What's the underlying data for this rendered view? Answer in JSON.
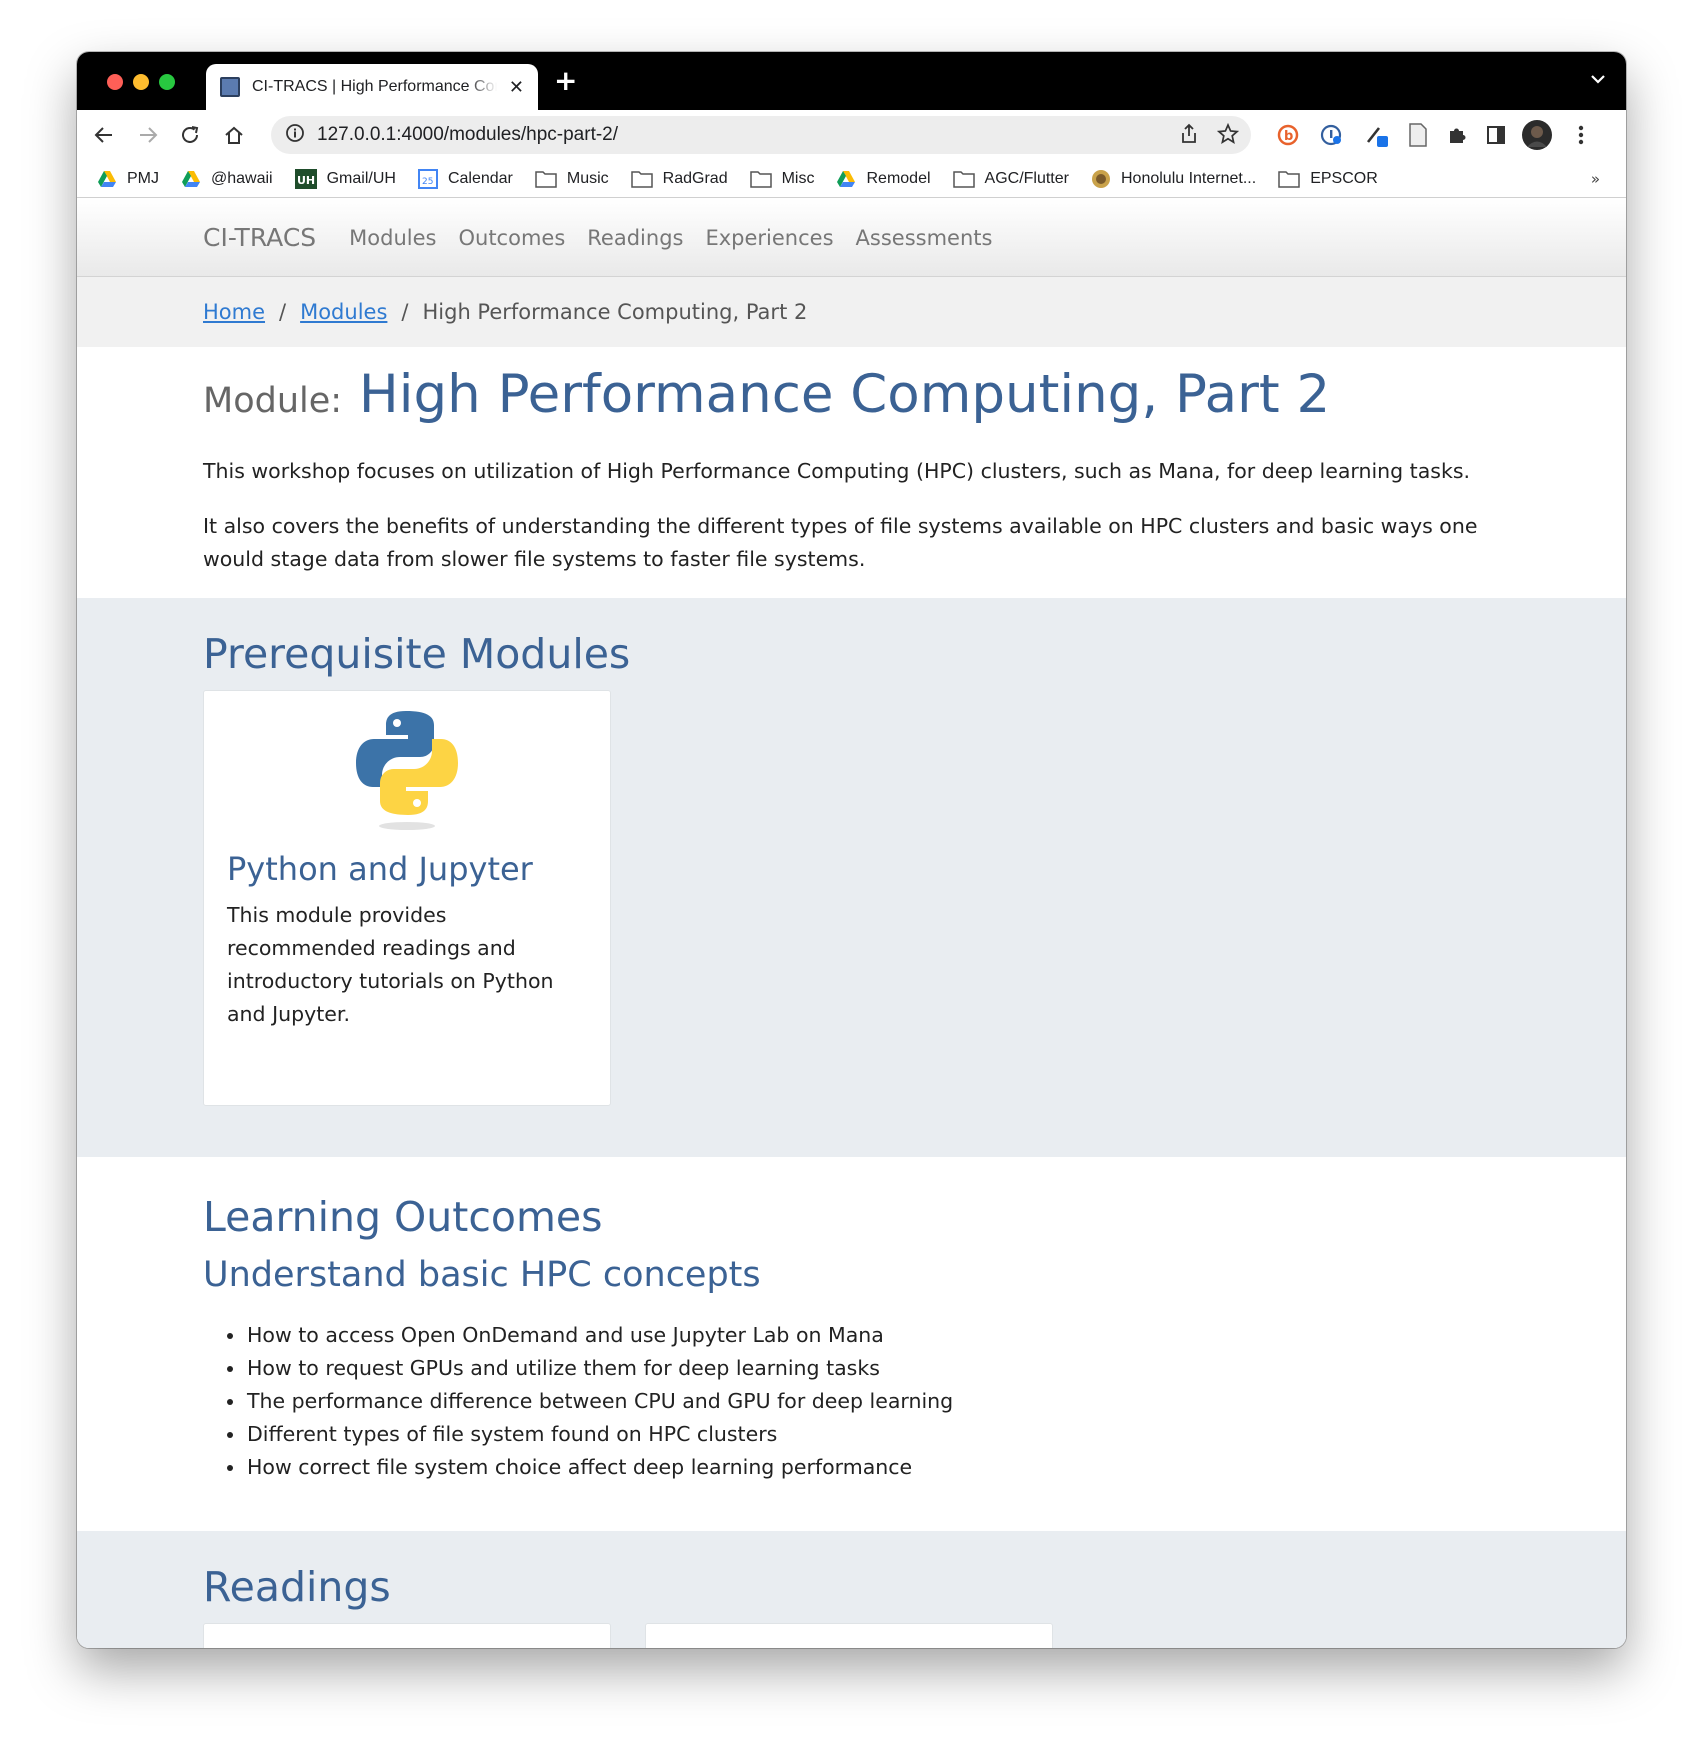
{
  "browser": {
    "tab_title": "CI-TRACS | High Performance Computing, Part 2",
    "url": "127.0.0.1:4000/modules/hpc-part-2/",
    "bookmarks": [
      "PMJ",
      "@hawaii",
      "Gmail/UH",
      "Calendar",
      "Music",
      "RadGrad",
      "Misc",
      "Remodel",
      "AGC/Flutter",
      "Honolulu Internet...",
      "EPSCOR"
    ],
    "bookmarks_more": "»",
    "close_glyph": "✕",
    "new_tab_glyph": "+"
  },
  "site": {
    "brand": "CI-TRACS",
    "nav": [
      "Modules",
      "Outcomes",
      "Readings",
      "Experiences",
      "Assessments"
    ]
  },
  "breadcrumb": {
    "home": "Home",
    "modules": "Modules",
    "separator": "/",
    "current": "High Performance Computing, Part 2"
  },
  "module": {
    "prefix": "Module:",
    "title": "High Performance Computing, Part 2",
    "description": [
      "This workshop focuses on utilization of High Performance Computing (HPC) clusters, such as Mana, for deep learning tasks.",
      "It also covers the benefits of understanding the different types of file systems available on HPC clusters and basic ways one would stage data from slower file systems to faster file systems."
    ]
  },
  "prerequisites": {
    "heading": "Prerequisite Modules",
    "cards": [
      {
        "title": "Python and Jupyter",
        "text": "This module provides recommended readings and introductory tutorials on Python and Jupyter.",
        "icon": "python-logo"
      }
    ]
  },
  "outcomes": {
    "heading": "Learning Outcomes",
    "subheading": "Understand basic HPC concepts",
    "items": [
      "How to access Open OnDemand and use Jupyter Lab on Mana",
      "How to request GPUs and utilize them for deep learning tasks",
      "The performance difference between CPU and GPU for deep learning",
      "Different types of file system found on HPC clusters",
      "How correct file system choice affect deep learning performance"
    ]
  },
  "readings": {
    "heading": "Readings"
  },
  "colors": {
    "accent": "#3b6294",
    "link": "#2f7ad1",
    "section_grey": "#e9edf1"
  }
}
